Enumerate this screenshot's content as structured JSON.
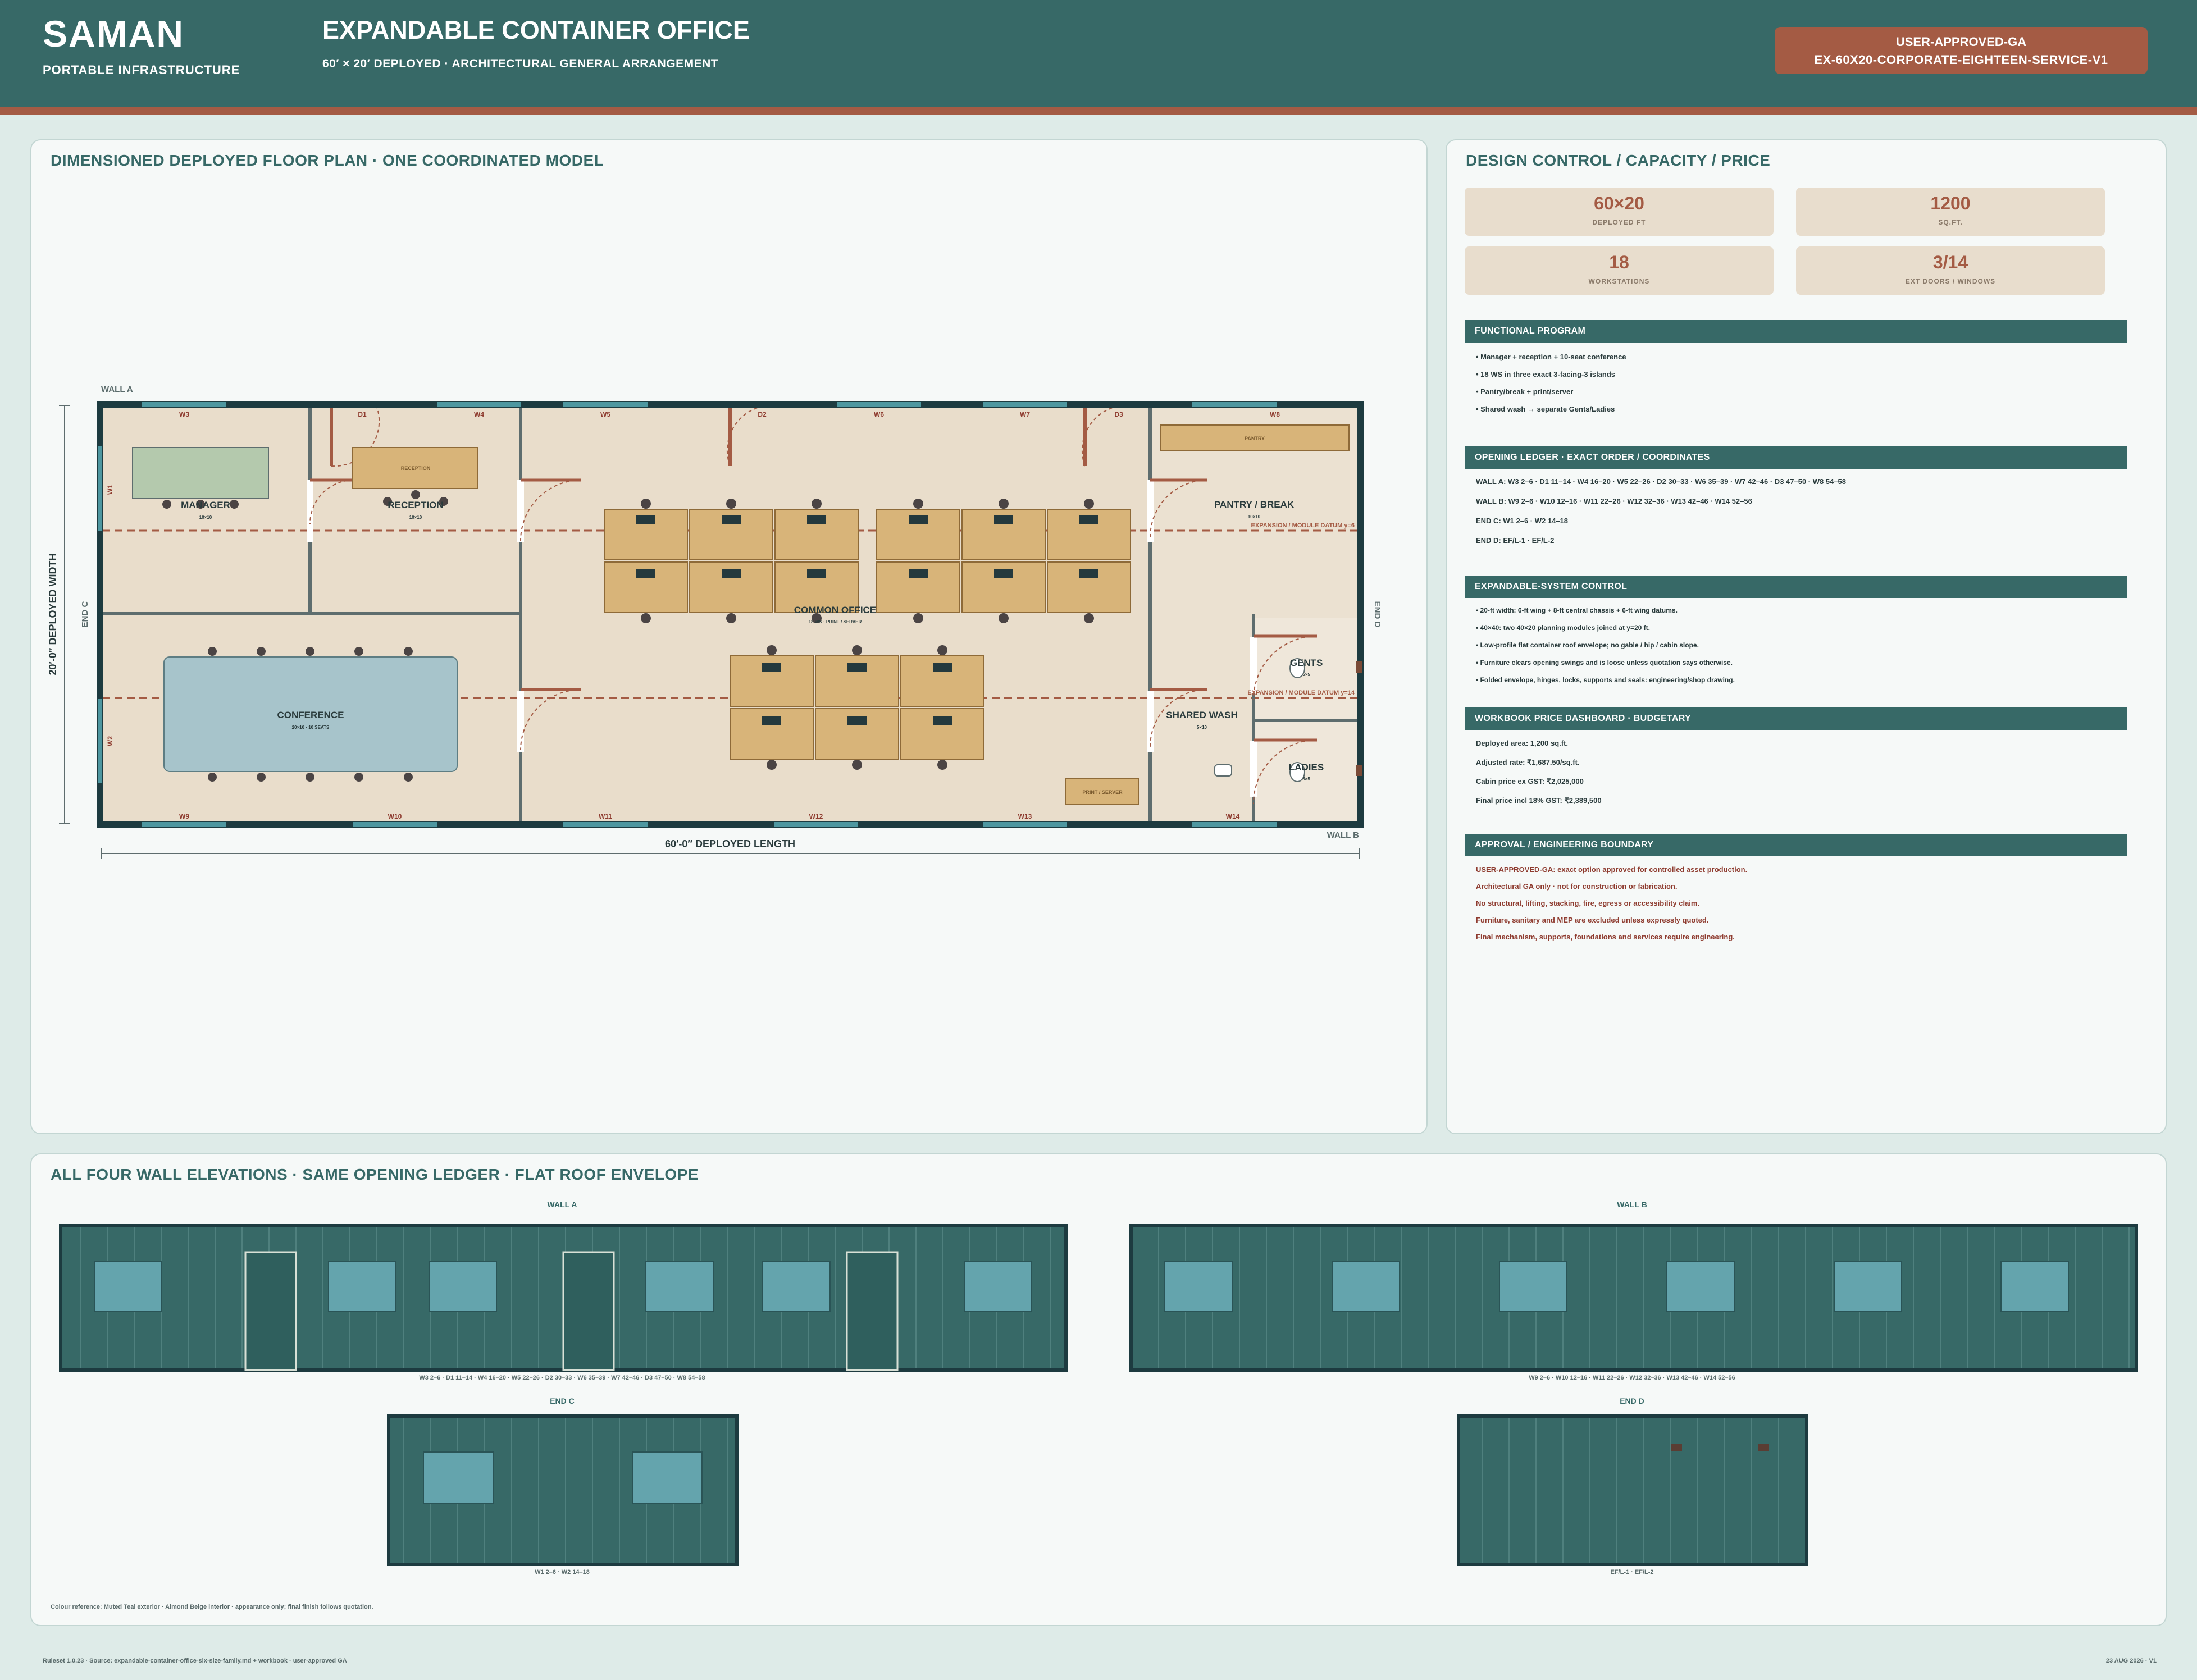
{
  "header": {
    "brand": "SAMAN",
    "brand_sub": "PORTABLE INFRASTRUCTURE",
    "title": "EXPANDABLE CONTAINER OFFICE",
    "subtitle": "60′ × 20′ DEPLOYED · ARCHITECTURAL GENERAL ARRANGEMENT",
    "badge_status": "USER-APPROVED-GA",
    "badge_code": "EX-60X20-CORPORATE-EIGHTEEN-SERVICE-V1"
  },
  "colors": {
    "teal": "#376967",
    "rust": "#a45b44",
    "beige": "#e9ddcb",
    "desk": "#d8b479"
  },
  "floor_plan": {
    "title": "DIMENSIONED DEPLOYED FLOOR PLAN · ONE COORDINATED MODEL",
    "wall_a": "WALL A",
    "wall_b": "WALL B",
    "end_c": "END C",
    "end_d": "END D",
    "width_dim": "20′-0″ DEPLOYED WIDTH",
    "length_dim": "60′-0″ DEPLOYED LENGTH",
    "rooms": {
      "manager": "MANAGER",
      "manager_size": "10×10",
      "reception": "RECEPTION",
      "reception_size": "10×10",
      "reception_desk": "RECEPTION",
      "conference": "CONFERENCE",
      "conference_size": "20×10 · 10 SEATS",
      "common": "COMMON OFFICE",
      "common_note": "18 WS · PRINT / SERVER",
      "pantry": "PANTRY / BREAK",
      "pantry_size": "10×10",
      "pantry_counter": "PANTRY",
      "shared_wash": "SHARED WASH",
      "shared_wash_size": "5×10",
      "gents": "GENTS",
      "gents_size": "5×5",
      "ladies": "LADIES",
      "ladies_size": "5×5",
      "print": "PRINT / SERVER"
    },
    "datum_1": "EXPANSION / MODULE DATUM y=6",
    "datum_2": "EXPANSION / MODULE DATUM y=14",
    "openings_top": [
      "W3",
      "D1",
      "W4",
      "W5",
      "D2",
      "W6",
      "W7",
      "D3",
      "W8"
    ],
    "openings_bottom": [
      "W9",
      "W10",
      "W11",
      "W12",
      "W13",
      "W14"
    ],
    "openings_left": [
      "W1",
      "W2"
    ]
  },
  "design": {
    "title": "DESIGN CONTROL / CAPACITY / PRICE",
    "cards": [
      {
        "value": "60×20",
        "label": "DEPLOYED FT"
      },
      {
        "value": "1200",
        "label": "SQ.FT."
      },
      {
        "value": "18",
        "label": "WORKSTATIONS"
      },
      {
        "value": "3/14",
        "label": "EXT DOORS / WINDOWS"
      }
    ],
    "functional_title": "FUNCTIONAL PROGRAM",
    "functional": [
      "• Manager + reception + 10-seat conference",
      "• 18 WS in three exact 3-facing-3 islands",
      "• Pantry/break + print/server",
      "• Shared wash → separate Gents/Ladies"
    ],
    "ledger_title": "OPENING LEDGER · EXACT ORDER / COORDINATES",
    "ledger": [
      "WALL A: W3 2–6 · D1 11–14 · W4 16–20 · W5 22–26 · D2 30–33 · W6 35–39 · W7 42–46 · D3 47–50 · W8 54–58",
      "WALL B: W9 2–6 · W10 12–16 · W11 22–26 · W12 32–36 · W13 42–46 · W14 52–56",
      "END C: W1 2–6 · W2 14–18",
      "END D: EF/L-1 · EF/L-2"
    ],
    "expand_title": "EXPANDABLE-SYSTEM CONTROL",
    "expand": [
      "• 20-ft width: 6-ft wing + 8-ft central chassis + 6-ft wing datums.",
      "• 40×40: two 40×20 planning modules joined at y=20 ft.",
      "• Low-profile flat container roof envelope; no gable / hip / cabin slope.",
      "• Furniture clears opening swings and is loose unless quotation says otherwise.",
      "• Folded envelope, hinges, locks, supports and seals: engineering/shop drawing."
    ],
    "price_title": "WORKBOOK PRICE DASHBOARD · BUDGETARY",
    "price": [
      "Deployed area: 1,200 sq.ft.",
      "Adjusted rate: ₹1,687.50/sq.ft.",
      "Cabin price ex GST: ₹2,025,000",
      "Final price incl 18% GST: ₹2,389,500"
    ],
    "approval_title": "APPROVAL / ENGINEERING BOUNDARY",
    "approval": [
      "USER-APPROVED-GA: exact option approved for controlled asset production.",
      "Architectural GA only · not for construction or fabrication.",
      "No structural, lifting, stacking, fire, egress or accessibility claim.",
      "Furniture, sanitary and MEP are excluded unless expressly quoted.",
      "Final mechanism, supports, foundations and services require engineering."
    ]
  },
  "elevations": {
    "title": "ALL FOUR WALL ELEVATIONS · SAME OPENING LEDGER · FLAT ROOF ENVELOPE",
    "wall_a": "WALL A",
    "wall_a_caption": "W3 2–6 · D1 11–14 · W4 16–20 · W5 22–26 · D2 30–33 · W6 35–39 · W7 42–46 · D3 47–50 · W8 54–58",
    "wall_b": "WALL B",
    "wall_b_caption": "W9 2–6 · W10 12–16 · W11 22–26 · W12 32–36 · W13 42–46 · W14 52–56",
    "end_c": "END C",
    "end_c_caption": "W1 2–6 · W2 14–18",
    "end_d": "END D",
    "end_d_caption": "EF/L-1 · EF/L-2",
    "colour_note": "Colour reference: Muted Teal exterior · Almond Beige interior · appearance only; final finish follows quotation."
  },
  "footer": {
    "left": "Ruleset 1.0.23 · Source: expandable-container-office-six-size-family.md + workbook · user-approved GA",
    "right": "23 AUG 2026 · V1"
  }
}
